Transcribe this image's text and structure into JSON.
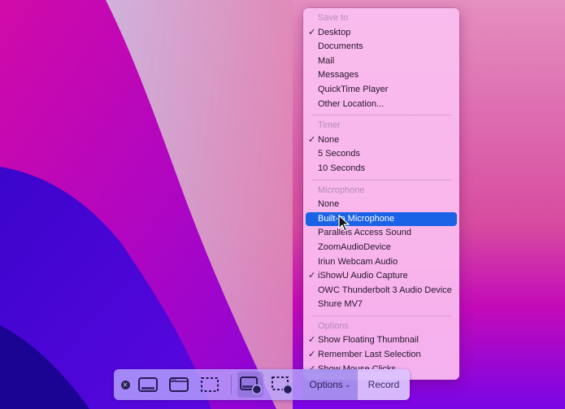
{
  "menu": {
    "sections": [
      {
        "header": "Save to",
        "items": [
          {
            "label": "Desktop",
            "checked": "✓"
          },
          {
            "label": "Documents",
            "checked": ""
          },
          {
            "label": "Mail",
            "checked": ""
          },
          {
            "label": "Messages",
            "checked": ""
          },
          {
            "label": "QuickTime Player",
            "checked": ""
          },
          {
            "label": "Other Location...",
            "checked": ""
          }
        ]
      },
      {
        "header": "Timer",
        "items": [
          {
            "label": "None",
            "checked": "✓"
          },
          {
            "label": "5 Seconds",
            "checked": ""
          },
          {
            "label": "10 Seconds",
            "checked": ""
          }
        ]
      },
      {
        "header": "Microphone",
        "items": [
          {
            "label": "None",
            "checked": ""
          },
          {
            "label": "Built-in Microphone",
            "checked": "",
            "highlighted": true
          },
          {
            "label": "Parallels Access Sound",
            "checked": ""
          },
          {
            "label": "ZoomAudioDevice",
            "checked": ""
          },
          {
            "label": "Iriun Webcam Audio",
            "checked": ""
          },
          {
            "label": "iShowU Audio Capture",
            "checked": "✓"
          },
          {
            "label": "OWC Thunderbolt 3 Audio Device",
            "checked": ""
          },
          {
            "label": "Shure MV7",
            "checked": ""
          }
        ]
      },
      {
        "header": "Options",
        "items": [
          {
            "label": "Show Floating Thumbnail",
            "checked": "✓"
          },
          {
            "label": "Remember Last Selection",
            "checked": "✓"
          },
          {
            "label": "Show Mouse Clicks",
            "checked": "✓"
          }
        ]
      }
    ]
  },
  "toolbar": {
    "close_icon": "close-icon",
    "options_label": "Options",
    "options_chevron": "⌄",
    "record_label": "Record",
    "close_glyph": "✕"
  },
  "colors": {
    "highlight": "#1a62e6",
    "menu_bg": "#fbbef0"
  }
}
